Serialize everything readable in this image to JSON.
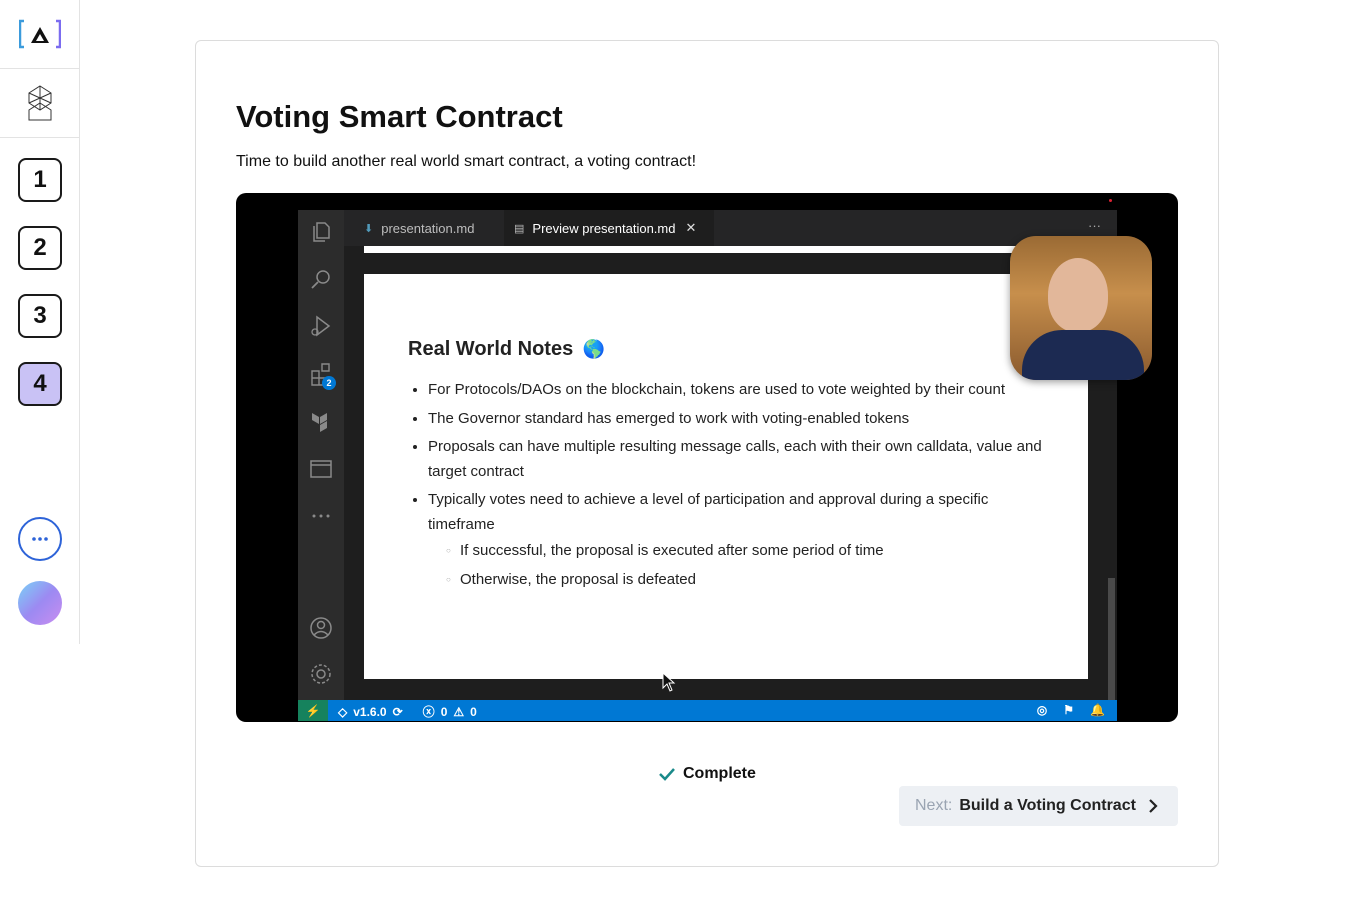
{
  "sidebar": {
    "steps": [
      "1",
      "2",
      "3",
      "4"
    ],
    "active_step": "4"
  },
  "lesson": {
    "title": "Voting Smart Contract",
    "subtitle": "Time to build another real world smart contract, a voting contract!"
  },
  "video": {
    "tabs": [
      "presentation.md",
      "Preview presentation.md"
    ],
    "extensions_badge": "2",
    "slide_title": "Real World Notes",
    "slide_emoji": "🌎",
    "bullets": [
      "For Protocols/DAOs on the blockchain, tokens are used to vote weighted by their count",
      "The Governor standard has emerged to work with voting-enabled tokens",
      "Proposals can have multiple resulting message calls, each with their own calldata, value and target contract",
      "Typically votes need to achieve a level of participation and approval during a specific timeframe"
    ],
    "sub_bullets": [
      "If successful, the proposal is executed after some period of time",
      "Otherwise, the proposal is defeated"
    ],
    "status": {
      "version": "v1.6.0",
      "errors": "0",
      "warnings": "0"
    }
  },
  "complete_label": "Complete",
  "next": {
    "prefix": "Next:",
    "label": "Build a Voting Contract"
  },
  "colors": {
    "active_step_bg": "#c9c2f5",
    "statusbar": "#0078d4",
    "complete_check": "#1a8a8a"
  }
}
